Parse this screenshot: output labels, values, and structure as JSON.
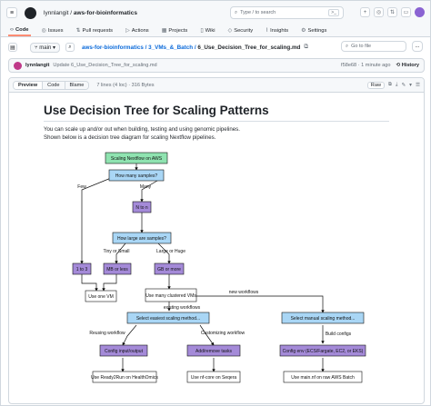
{
  "header": {
    "user": "lynnlangit",
    "repo": "aws-for-bioinformatics",
    "search_placeholder": "Type / to search",
    "search_key": ">_"
  },
  "tabs": [
    {
      "label": "Code",
      "icon": "code-icon"
    },
    {
      "label": "Issues",
      "icon": "issue-icon"
    },
    {
      "label": "Pull requests",
      "icon": "pr-icon"
    },
    {
      "label": "Actions",
      "icon": "play-icon"
    },
    {
      "label": "Projects",
      "icon": "table-icon"
    },
    {
      "label": "Wiki",
      "icon": "book-icon"
    },
    {
      "label": "Security",
      "icon": "shield-icon"
    },
    {
      "label": "Insights",
      "icon": "graph-icon"
    },
    {
      "label": "Settings",
      "icon": "gear-icon"
    }
  ],
  "file": {
    "branch": "main",
    "path_repo": "aws-for-bioinformatics",
    "path_dir": "3_VMs_&_Batch",
    "path_file": "6_Use_Decision_Tree_for_scaling.md",
    "goto_placeholder": "Go to file",
    "more": "..."
  },
  "commit": {
    "author": "lynnlangit",
    "message": "Update 6_Use_Decision_Tree_for_scaling.md",
    "sha_time": "f58e68 · 1 minute ago",
    "history": "History"
  },
  "viewer": {
    "preview": "Preview",
    "code": "Code",
    "blame": "Blame",
    "meta": "7 lines (4 loc) · 316 Bytes",
    "raw": "Raw"
  },
  "doc": {
    "title": "Use Decision Tree for Scaling Patterns",
    "line1": "You can scale up and/or out when building, testing and using genomic pipelines.",
    "line2": "Shown below is a decision tree diagram for scaling Nextflow pipelines."
  },
  "diagram": {
    "start": "Scaling Nextflow on AWS",
    "q1": "How many samples?",
    "few": "Few",
    "many": "Many",
    "n6": "N to n",
    "q2": "How large are samples?",
    "tiny": "Tiny or Small",
    "large": "Large or Huge",
    "n1to3": "1 to 3",
    "mb": "MB or less",
    "gb": "GB or more",
    "one_vm": "Use one VM",
    "many_vms": "Use many clustered VMs",
    "existing": "existing workflows",
    "new_wf": "new workflows",
    "easiest": "Select easiest scaling method...",
    "manual": "Select manual scaling method...",
    "reusing": "Reusing workflow",
    "customizing": "Customizing workflow",
    "build_configs": "Build configs",
    "config_io": "Config input/output",
    "add_remove": "Add/remove tasks",
    "config_env": "Config env (ECS/Fargate, EC2, or EKS)",
    "ready2run": "Use Ready2Run on HealthOmics",
    "seqera": "Use nf-core on Seqera",
    "batch": "Use main.nf on raw AWS Batch"
  },
  "colors": {
    "green": "#8fe3b0",
    "blue": "#a9d6f5",
    "purple": "#a48ad8",
    "accent": "#fd8c73"
  }
}
